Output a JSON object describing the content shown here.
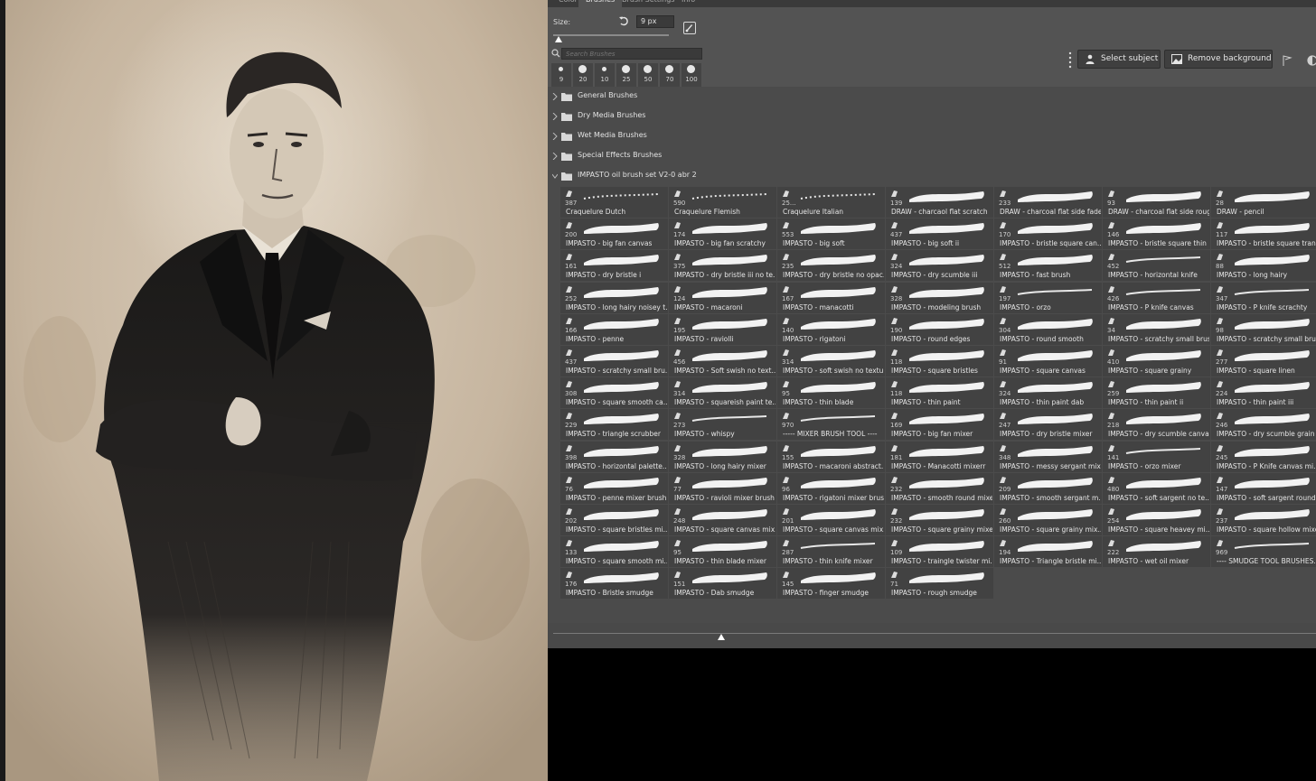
{
  "tabs": [
    "Color",
    "Brushes",
    "Brush Settings",
    "Info"
  ],
  "brush_panel": {
    "size_label": "Size:",
    "size_value": "9 px",
    "size_slider_fraction": 0.02,
    "search_placeholder": "Search Brushes",
    "presets": [
      "9",
      "20",
      "10",
      "25",
      "50",
      "70",
      "100"
    ]
  },
  "toolbar": {
    "select_subject": "Select subject",
    "remove_background": "Remove background"
  },
  "groups": [
    "General Brushes",
    "Dry Media Brushes",
    "Wet Media Brushes",
    "Special Effects Brushes",
    "IMPASTO oil brush set V2-0 abr 2"
  ],
  "brushes": [
    {
      "count": "387",
      "name": "Craquelure Dutch"
    },
    {
      "count": "590",
      "name": "Craquelure Flemish"
    },
    {
      "count": "25...",
      "name": "Craquelure Italian"
    },
    {
      "count": "139",
      "name": "DRAW - charcaol flat scratch"
    },
    {
      "count": "233",
      "name": "DRAW - charcoal flat side fade"
    },
    {
      "count": "93",
      "name": "DRAW - charcoal flat side rough"
    },
    {
      "count": "28",
      "name": "DRAW - pencil"
    },
    {
      "count": "200",
      "name": "IMPASTO - big fan canvas"
    },
    {
      "count": "174",
      "name": "IMPASTO - big fan scratchy"
    },
    {
      "count": "553",
      "name": "IMPASTO - big soft"
    },
    {
      "count": "437",
      "name": "IMPASTO - big soft ii"
    },
    {
      "count": "170",
      "name": "IMPASTO - bristle square can..."
    },
    {
      "count": "146",
      "name": "IMPASTO - bristle square thin"
    },
    {
      "count": "117",
      "name": "IMPASTO - bristle square tran..."
    },
    {
      "count": "161",
      "name": "IMPASTO - dry bristle i"
    },
    {
      "count": "375",
      "name": "IMPASTO - dry bristle iii no te..."
    },
    {
      "count": "235",
      "name": "IMPASTO - dry bristle no opac..."
    },
    {
      "count": "324",
      "name": "IMPASTO - dry scumble iii"
    },
    {
      "count": "512",
      "name": "IMPASTO - fast brush"
    },
    {
      "count": "452",
      "name": "IMPASTO - horizontal knife"
    },
    {
      "count": "88",
      "name": "IMPASTO - long hairy"
    },
    {
      "count": "252",
      "name": "IMPASTO - long hairy noisey t..."
    },
    {
      "count": "124",
      "name": "IMPASTO - macaroni"
    },
    {
      "count": "167",
      "name": "IMPASTO - manacotti"
    },
    {
      "count": "328",
      "name": "IMPASTO - modeling brush"
    },
    {
      "count": "197",
      "name": "IMPASTO - orzo"
    },
    {
      "count": "426",
      "name": "IMPASTO - P knife canvas"
    },
    {
      "count": "347",
      "name": "IMPASTO - P knife scrachty"
    },
    {
      "count": "166",
      "name": "IMPASTO - penne"
    },
    {
      "count": "195",
      "name": "IMPASTO - raviolli"
    },
    {
      "count": "140",
      "name": "IMPASTO - rigatoni"
    },
    {
      "count": "190",
      "name": "IMPASTO - round edges"
    },
    {
      "count": "304",
      "name": "IMPASTO - round smooth"
    },
    {
      "count": "34",
      "name": "IMPASTO - scratchy small brush"
    },
    {
      "count": "98",
      "name": "IMPASTO - scratchy small bru..."
    },
    {
      "count": "437",
      "name": "IMPASTO - scratchy small bru..."
    },
    {
      "count": "456",
      "name": "IMPASTO - Soft swish no text..."
    },
    {
      "count": "314",
      "name": "IMPASTO - soft swish no textu..."
    },
    {
      "count": "118",
      "name": "IMPASTO - square bristles"
    },
    {
      "count": "91",
      "name": "IMPASTO - square canvas"
    },
    {
      "count": "410",
      "name": "IMPASTO - square grainy"
    },
    {
      "count": "277",
      "name": "IMPASTO - square linen"
    },
    {
      "count": "308",
      "name": "IMPASTO - square smooth ca..."
    },
    {
      "count": "314",
      "name": "IMPASTO - squareish paint te..."
    },
    {
      "count": "95",
      "name": "IMPASTO - thin blade"
    },
    {
      "count": "118",
      "name": "IMPASTO - thin paint"
    },
    {
      "count": "324",
      "name": "IMPASTO - thin paint dab"
    },
    {
      "count": "259",
      "name": "IMPASTO - thin paint ii"
    },
    {
      "count": "224",
      "name": "IMPASTO - thin paint iii"
    },
    {
      "count": "229",
      "name": "IMPASTO - triangle scrubber"
    },
    {
      "count": "273",
      "name": "IMPASTO - whispy"
    },
    {
      "count": "970",
      "name": "----- MIXER BRUSH TOOL ----"
    },
    {
      "count": "169",
      "name": "IMPASTO - big fan mixer"
    },
    {
      "count": "247",
      "name": "IMPASTO - dry bristle mixer"
    },
    {
      "count": "218",
      "name": "IMPASTO - dry scumble canva..."
    },
    {
      "count": "246",
      "name": "IMPASTO - dry scumble grain"
    },
    {
      "count": "398",
      "name": "IMPASTO - horizontal palette..."
    },
    {
      "count": "328",
      "name": "IMPASTO - long hairy mixer"
    },
    {
      "count": "155",
      "name": "IMPASTO - macaroni abstract..."
    },
    {
      "count": "181",
      "name": "IMPASTO - Manacotti mixerr"
    },
    {
      "count": "348",
      "name": "IMPASTO - messy sergant mix..."
    },
    {
      "count": "141",
      "name": "IMPASTO - orzo mixer"
    },
    {
      "count": "245",
      "name": "IMPASTO - P Knife canvas mi..."
    },
    {
      "count": "76",
      "name": "IMPASTO - penne mixer brush"
    },
    {
      "count": "77",
      "name": "IMPASTO - ravioli mixer brush"
    },
    {
      "count": "96",
      "name": "IMPASTO - rigatoni mixer brush"
    },
    {
      "count": "232",
      "name": "IMPASTO - smooth round mixer"
    },
    {
      "count": "209",
      "name": "IMPASTO - smooth sergant m..."
    },
    {
      "count": "480",
      "name": "IMPASTO - soft sargent no te..."
    },
    {
      "count": "147",
      "name": "IMPASTO - soft sargent round..."
    },
    {
      "count": "202",
      "name": "IMPASTO - square bristles mi..."
    },
    {
      "count": "248",
      "name": "IMPASTO - square canvas mix..."
    },
    {
      "count": "201",
      "name": "IMPASTO - square canvas mix..."
    },
    {
      "count": "232",
      "name": "IMPASTO - square grainy mixer"
    },
    {
      "count": "260",
      "name": "IMPASTO - square grainy mix..."
    },
    {
      "count": "254",
      "name": "IMPASTO - square heavey mi..."
    },
    {
      "count": "237",
      "name": "IMPASTO - square hollow mixer"
    },
    {
      "count": "133",
      "name": "IMPASTO - square smooth mi..."
    },
    {
      "count": "95",
      "name": "IMPASTO - thin blade mixer"
    },
    {
      "count": "287",
      "name": "IMPASTO - thin knife mixer"
    },
    {
      "count": "109",
      "name": "IMPASTO - traingle twister mi..."
    },
    {
      "count": "194",
      "name": "IMPASTO - Triangle bristle mi..."
    },
    {
      "count": "222",
      "name": "IMPASTO - wet oil mixer"
    },
    {
      "count": "969",
      "name": "---- SMUDGE TOOL BRUSHES..."
    },
    {
      "count": "176",
      "name": "IMPASTO - Bristle smudge"
    },
    {
      "count": "151",
      "name": "IMPASTO - Dab smudge"
    },
    {
      "count": "145",
      "name": "IMPASTO - finger smudge"
    },
    {
      "count": "71",
      "name": "IMPASTO - rough smudge"
    }
  ],
  "thumbnail_zoom_fraction": 0.22,
  "colors": {
    "panel_bg": "#4b4b4b",
    "cell_bg": "#424242",
    "paper": "#c9b9a4",
    "charcoal": "#1c1b1a"
  }
}
